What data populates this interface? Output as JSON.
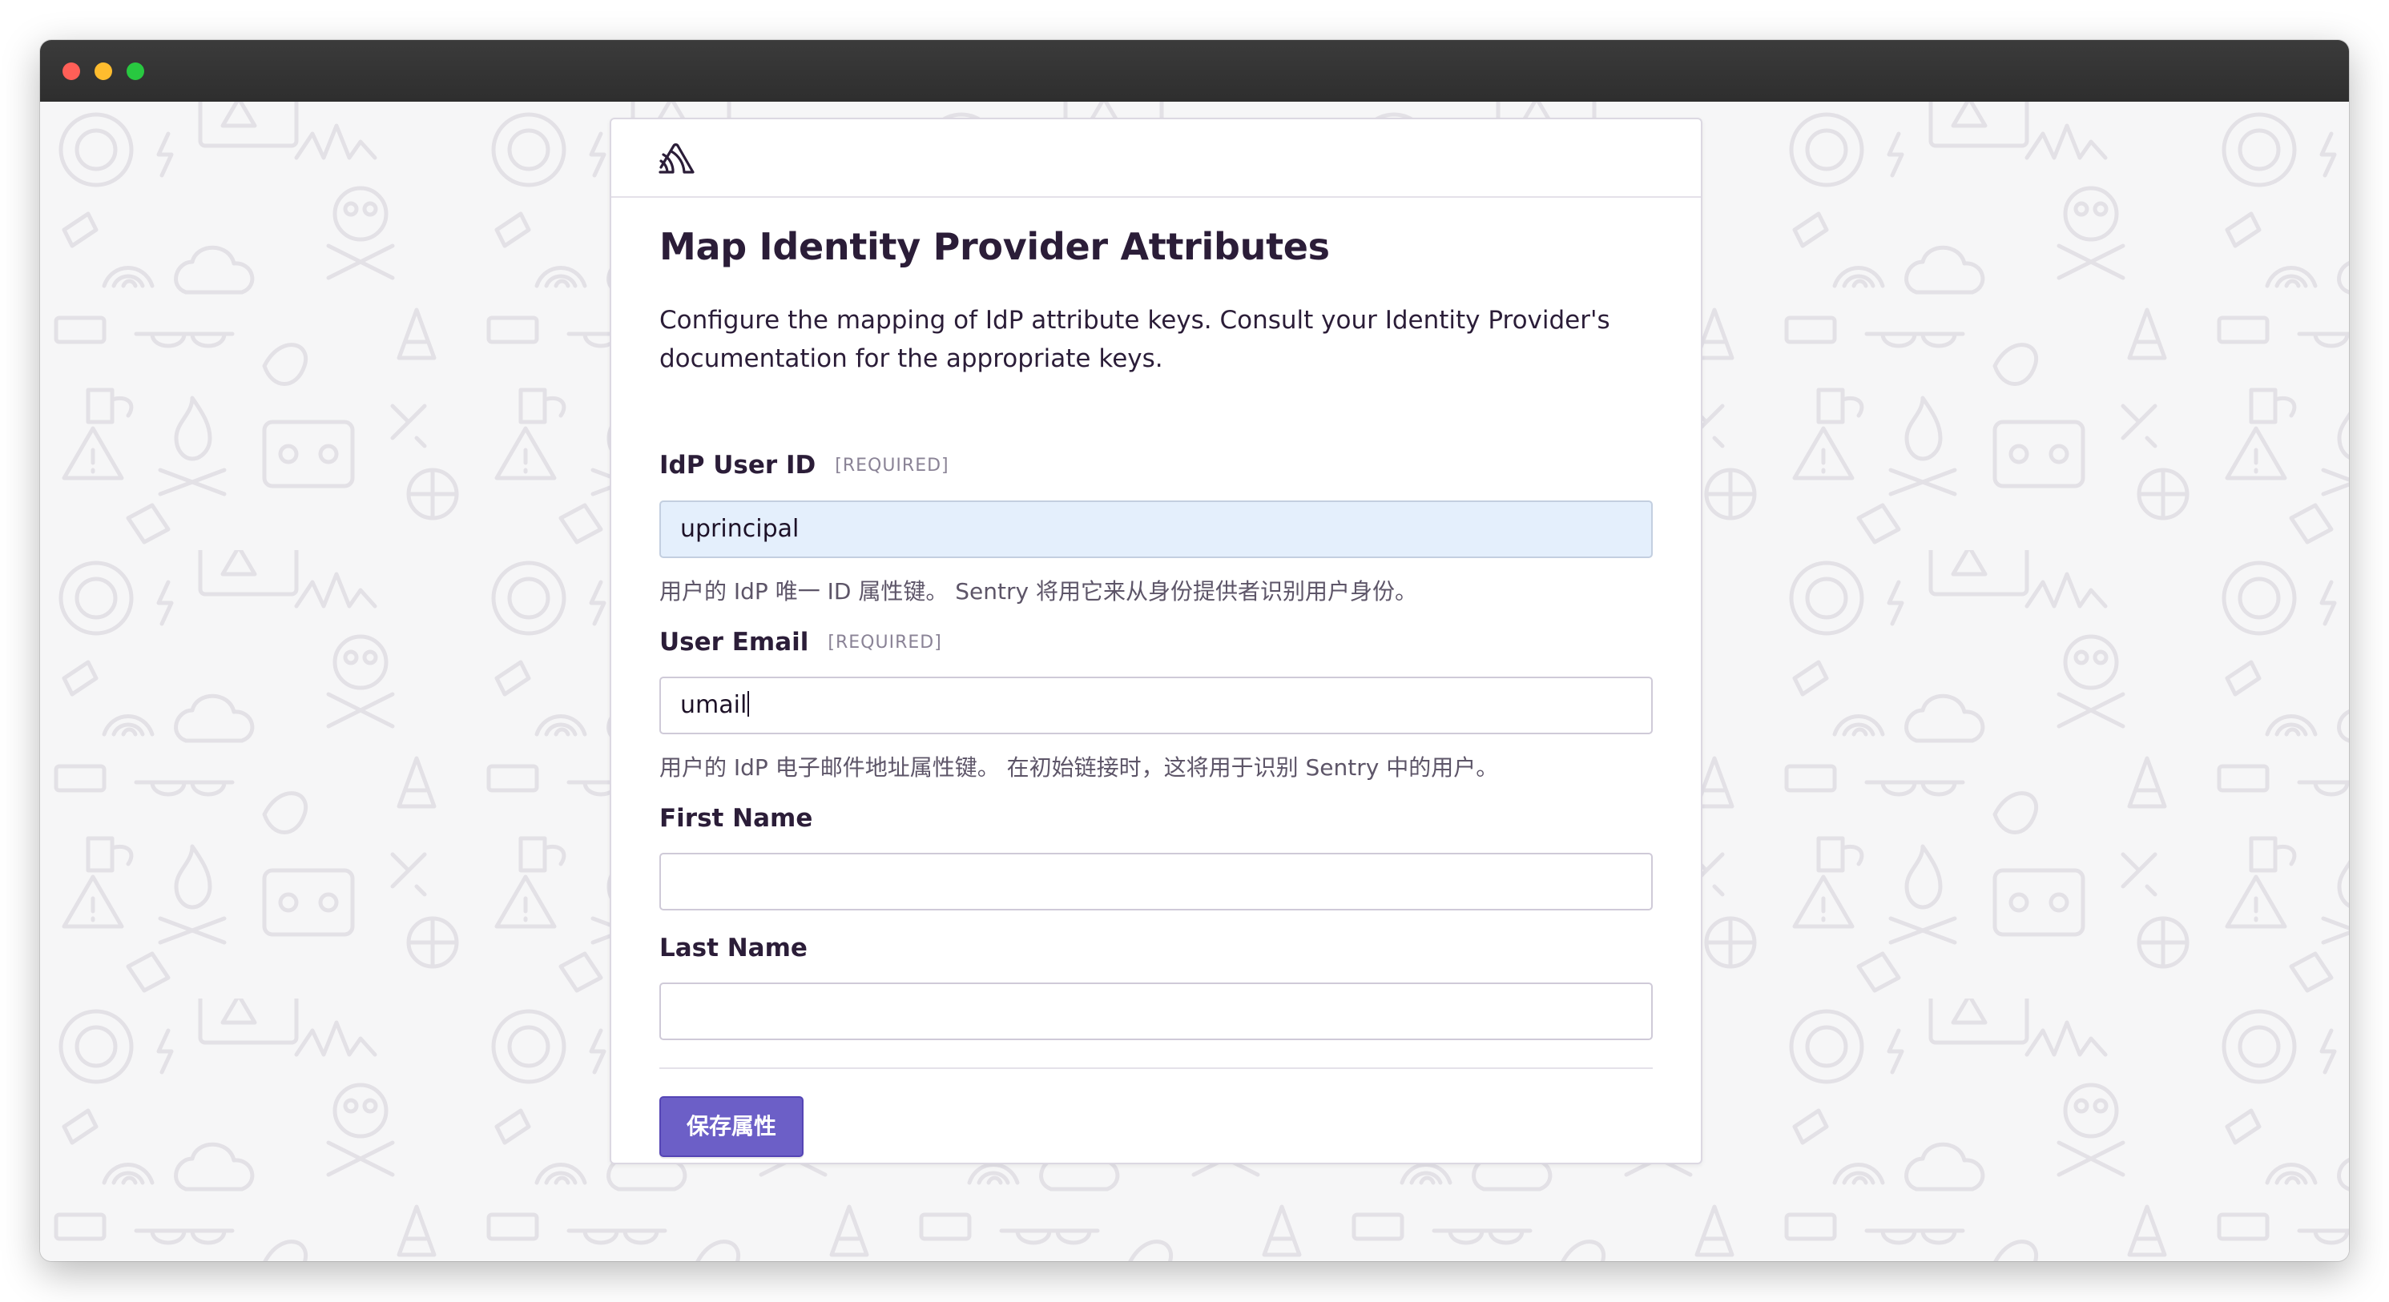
{
  "window": {
    "controls": [
      "close",
      "minimize",
      "zoom"
    ],
    "background_watermark": "Sentry"
  },
  "card": {
    "logo_icon": "sentry-logo-icon",
    "title": "Map Identity Provider Attributes",
    "description": "Configure the mapping of IdP attribute keys. Consult your Identity Provider's documentation for the appropriate keys.",
    "required_tag": "[REQUIRED]",
    "fields": {
      "user_id": {
        "label": "IdP User ID",
        "value": "uprincipal",
        "help": "用户的 IdP 唯一 ID 属性键。 Sentry 将用它来从身份提供者识别用户身份。"
      },
      "user_email": {
        "label": "User Email",
        "value": "umail",
        "help": "用户的 IdP 电子邮件地址属性键。 在初始链接时，这将用于识别 Sentry 中的用户。"
      },
      "first_name": {
        "label": "First Name",
        "value": ""
      },
      "last_name": {
        "label": "Last Name",
        "value": ""
      }
    },
    "save_button": "保存属性"
  },
  "colors": {
    "accent": "#6c5fc7",
    "text": "#2b1d38",
    "autofill": "#e4effc"
  }
}
